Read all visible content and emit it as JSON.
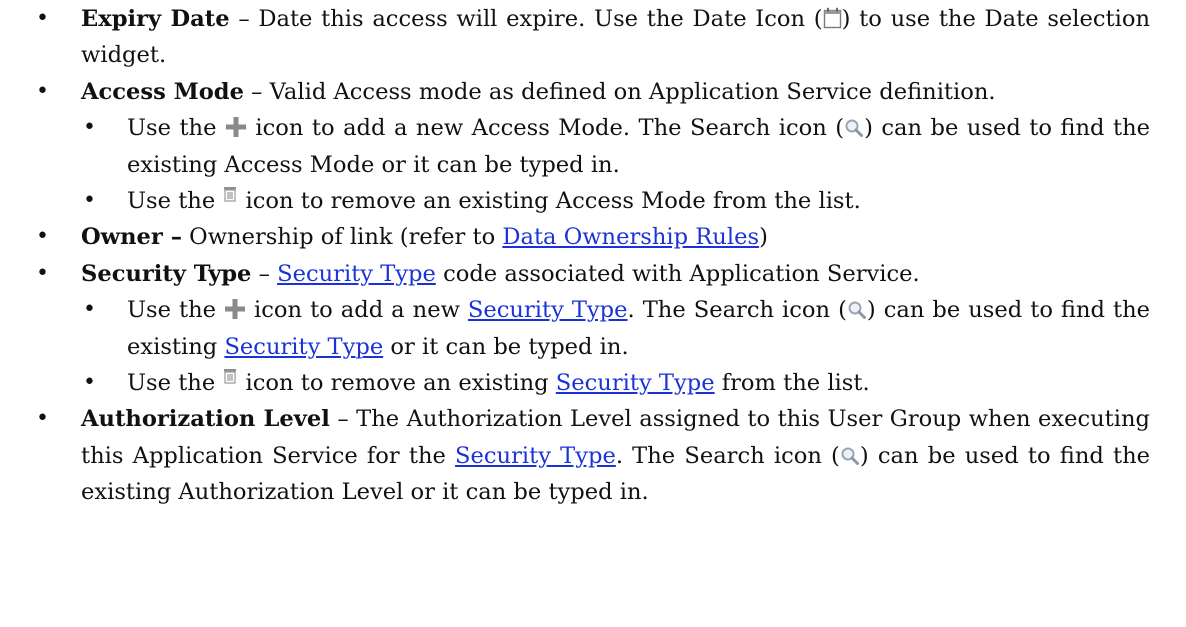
{
  "items": {
    "expiry": {
      "term": "Expiry Date",
      "sep": " – ",
      "text_a": "Date this access will expire. Use the Date Icon (",
      "text_b": ") to use the Date selection widget.",
      "icon": "calendar-icon"
    },
    "access_mode": {
      "term": "Access Mode",
      "sep": " – ",
      "text": "Valid Access mode as defined on Application Service definition.",
      "sub_add": {
        "pre": "Use the ",
        "mid": " icon to add a new Access Mode. The Search icon (",
        "post": ") can be used to find the existing Access Mode or it can be typed in."
      },
      "sub_remove": {
        "pre": "Use the ",
        "post": " icon to remove an existing Access Mode from the list."
      }
    },
    "owner": {
      "term": "Owner –",
      "text_a": " Ownership of link (refer to ",
      "link": "Data Ownership Rules",
      "text_b": ")"
    },
    "security_type": {
      "term": "Security Type",
      "sep": " – ",
      "link": "Security Type",
      "text": " code associated with Application Service.",
      "sub_add": {
        "pre": "Use the ",
        "mid": " icon to add a new ",
        "mid2": ". The Search icon (",
        "mid3": ") can be used to find the existing ",
        "post": " or it can be typed in."
      },
      "sub_remove": {
        "pre": "Use the ",
        "mid": " icon to remove an existing ",
        "post": " from the list."
      }
    },
    "auth_level": {
      "term": "Authorization Level",
      "sep": " – ",
      "text_a": "The Authorization Level assigned to this User Group when executing this Application Service for the ",
      "link": "Security Type",
      "text_b": ". The Search icon (",
      "text_c": ") can be used to find the existing Authorization Level or it can be typed in."
    }
  },
  "bullets": {
    "l1": "•",
    "l2": "•"
  },
  "colors": {
    "link": "#1a32d8",
    "text": "#111111",
    "plus_icon": "#888888",
    "search_icon": "#9aa6b6"
  }
}
